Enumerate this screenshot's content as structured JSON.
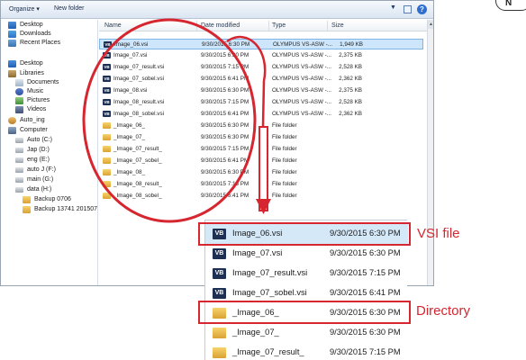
{
  "toolbar": {
    "organize": "Organize ▾",
    "new_folder": "New folder",
    "view_icon": "view-options-icon",
    "pane_icon": "preview-pane-icon",
    "help": "?"
  },
  "nav": {
    "items": [
      {
        "label": "Desktop",
        "icon": "desktop-icon"
      },
      {
        "label": "Downloads",
        "icon": "downloads-icon"
      },
      {
        "label": "Recent Places",
        "icon": "recent-places-icon"
      },
      {
        "label": "Desktop",
        "icon": "desktop-icon"
      },
      {
        "label": "Libraries",
        "icon": "libraries-icon"
      },
      {
        "label": "Documents",
        "icon": "documents-icon"
      },
      {
        "label": "Music",
        "icon": "music-icon"
      },
      {
        "label": "Pictures",
        "icon": "pictures-icon"
      },
      {
        "label": "Videos",
        "icon": "videos-icon"
      },
      {
        "label": "Auto_ing",
        "icon": "user-icon"
      },
      {
        "label": "Computer",
        "icon": "computer-icon"
      },
      {
        "label": "Auto (C:)",
        "icon": "drive-icon"
      },
      {
        "label": "Jap (D:)",
        "icon": "drive-icon"
      },
      {
        "label": "eng (E:)",
        "icon": "drive-icon"
      },
      {
        "label": "auto J (F:)",
        "icon": "drive-icon"
      },
      {
        "label": "main (G:)",
        "icon": "drive-icon"
      },
      {
        "label": "data (H:)",
        "icon": "drive-icon"
      },
      {
        "label": "Backup 0706",
        "icon": "folder-icon"
      },
      {
        "label": "Backup 13741 201507",
        "icon": "folder-icon"
      }
    ]
  },
  "columns": {
    "name": "Name",
    "date": "Date modified",
    "type": "Type",
    "size": "Size"
  },
  "files": [
    {
      "name": "Image_06.vsi",
      "date": "9/30/2015 6:30 PM",
      "type": "OLYMPUS VS-ASW -...",
      "size": "1,949 KB",
      "kind": "vsi"
    },
    {
      "name": "Image_07.vsi",
      "date": "9/30/2015 6:30 PM",
      "type": "OLYMPUS VS-ASW -...",
      "size": "2,375 KB",
      "kind": "vsi"
    },
    {
      "name": "Image_07_result.vsi",
      "date": "9/30/2015 7:15 PM",
      "type": "OLYMPUS VS-ASW -...",
      "size": "2,528 KB",
      "kind": "vsi"
    },
    {
      "name": "Image_07_sobel.vsi",
      "date": "9/30/2015 6:41 PM",
      "type": "OLYMPUS VS-ASW -...",
      "size": "2,362 KB",
      "kind": "vsi"
    },
    {
      "name": "Image_08.vsi",
      "date": "9/30/2015 6:30 PM",
      "type": "OLYMPUS VS-ASW -...",
      "size": "2,375 KB",
      "kind": "vsi"
    },
    {
      "name": "Image_08_result.vsi",
      "date": "9/30/2015 7:15 PM",
      "type": "OLYMPUS VS-ASW -...",
      "size": "2,528 KB",
      "kind": "vsi"
    },
    {
      "name": "Image_08_sobel.vsi",
      "date": "9/30/2015 6:41 PM",
      "type": "OLYMPUS VS-ASW -...",
      "size": "2,362 KB",
      "kind": "vsi"
    },
    {
      "name": "_Image_06_",
      "date": "9/30/2015 6:30 PM",
      "type": "File folder",
      "size": "",
      "kind": "folder"
    },
    {
      "name": "_Image_07_",
      "date": "9/30/2015 6:30 PM",
      "type": "File folder",
      "size": "",
      "kind": "folder"
    },
    {
      "name": "_Image_07_result_",
      "date": "9/30/2015 7:15 PM",
      "type": "File folder",
      "size": "",
      "kind": "folder"
    },
    {
      "name": "_Image_07_sobel_",
      "date": "9/30/2015 6:41 PM",
      "type": "File folder",
      "size": "",
      "kind": "folder"
    },
    {
      "name": "_Image_08_",
      "date": "9/30/2015 6:30 PM",
      "type": "File folder",
      "size": "",
      "kind": "folder"
    },
    {
      "name": "_Image_08_result_",
      "date": "9/30/2015 7:15 PM",
      "type": "File folder",
      "size": "",
      "kind": "folder"
    },
    {
      "name": "_Image_08_sobel_",
      "date": "9/30/2015 6:41 PM",
      "type": "File folder",
      "size": "",
      "kind": "folder"
    }
  ],
  "zoom_rows": [
    {
      "name": "Image_06.vsi",
      "date": "9/30/2015 6:30 PM",
      "kind": "vsi"
    },
    {
      "name": "Image_07.vsi",
      "date": "9/30/2015 6:30 PM",
      "kind": "vsi"
    },
    {
      "name": "Image_07_result.vsi",
      "date": "9/30/2015 7:15 PM",
      "kind": "vsi"
    },
    {
      "name": "Image_07_sobel.vsi",
      "date": "9/30/2015 6:41 PM",
      "kind": "vsi"
    },
    {
      "name": "_Image_06_",
      "date": "9/30/2015 6:30 PM",
      "kind": "folder"
    },
    {
      "name": "_Image_07_",
      "date": "9/30/2015 6:30 PM",
      "kind": "folder"
    },
    {
      "name": "_Image_07_result_",
      "date": "9/30/2015 7:15 PM",
      "kind": "folder"
    }
  ],
  "vsi_badge": "VB",
  "callouts": {
    "vsi": "VSI file",
    "dir": "Directory"
  },
  "badge": "N",
  "colors": {
    "highlight": "#d6262f",
    "selection": "#cde6fb"
  }
}
